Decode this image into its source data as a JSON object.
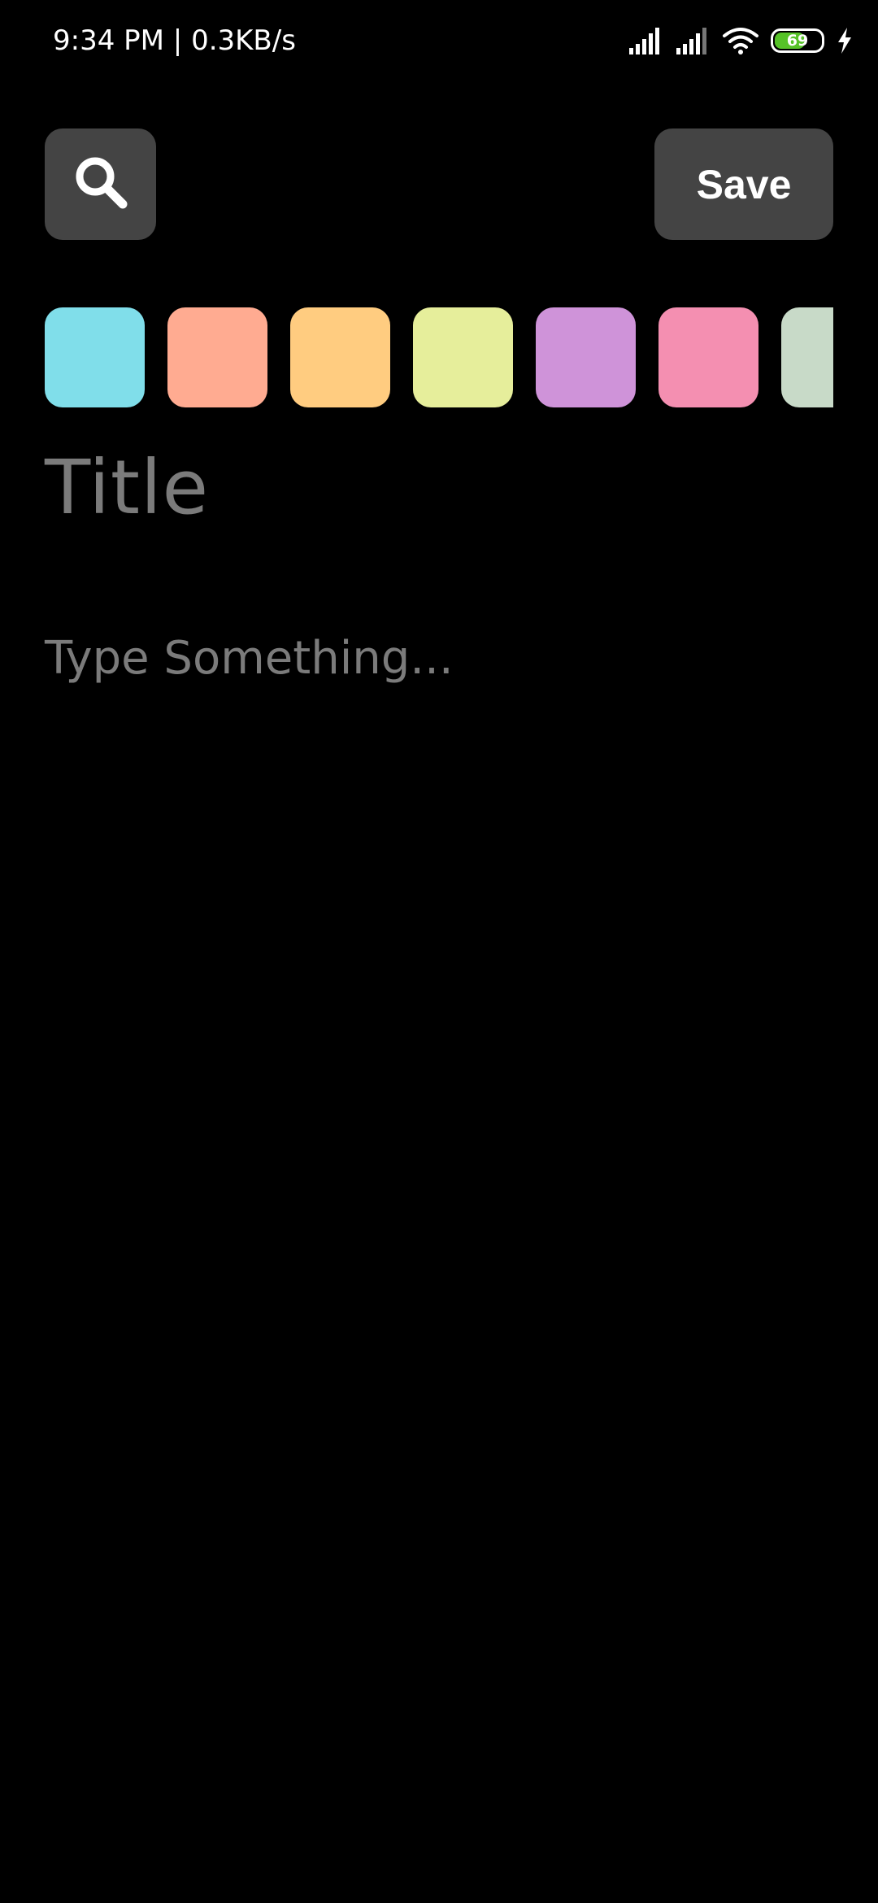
{
  "status_bar": {
    "time_speed": "9:34 PM | 0.3KB/s",
    "battery_level": "69",
    "battery_fraction": 0.69,
    "icons": [
      "signal-icon",
      "signal-icon",
      "wifi-icon",
      "battery-icon",
      "charging-icon"
    ],
    "colors": {
      "text": "#ffffff",
      "battery_fill": "#56c228"
    }
  },
  "toolbar": {
    "search_icon": "search-icon",
    "save_label": "Save",
    "button_color": "#444444"
  },
  "palette": {
    "colors": [
      "#80deea",
      "#ffab91",
      "#ffcc80",
      "#e6ee9b",
      "#cf93d9",
      "#f48fb1",
      "#c8dac8"
    ]
  },
  "editor": {
    "title_placeholder": "Title",
    "body_placeholder": "Type Something...",
    "placeholder_color": "#7b7b7b"
  }
}
